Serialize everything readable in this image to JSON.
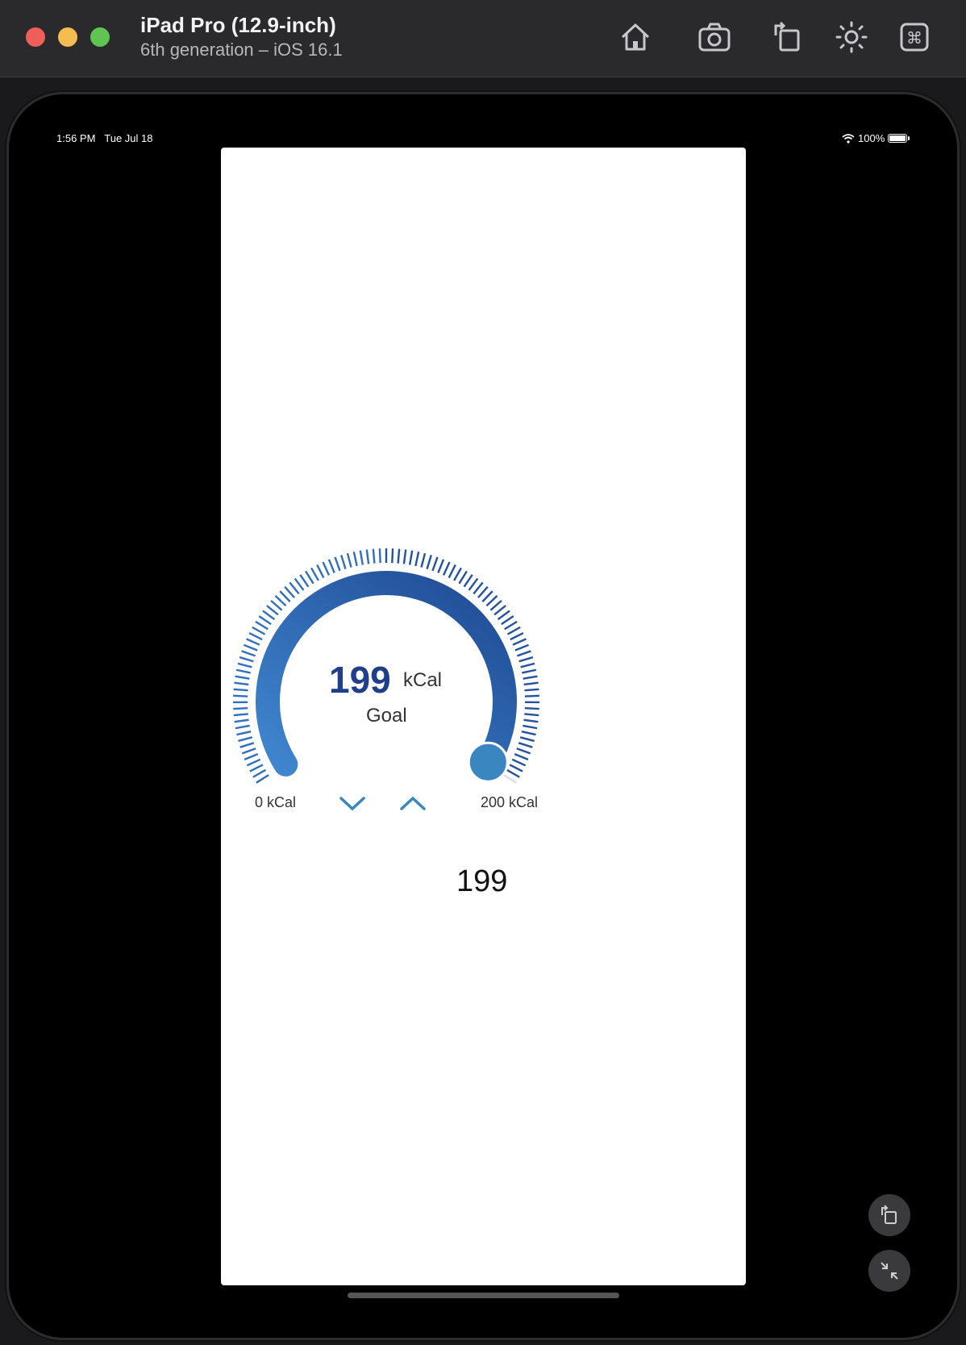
{
  "window": {
    "title": "iPad Pro (12.9-inch)",
    "subtitle": "6th generation – iOS 16.1"
  },
  "toolbar_icons": [
    "home-icon",
    "camera-icon",
    "rotate-icon",
    "brightness-icon",
    "command-icon"
  ],
  "status_bar": {
    "time": "1:56 PM",
    "date": "Tue Jul 18",
    "battery": "100%"
  },
  "gauge": {
    "value": "199",
    "unit": "kCal",
    "caption": "Goal",
    "min_label": "0 kCal",
    "max_label": "200 kCal",
    "min": 0,
    "max": 200,
    "current": 199,
    "track_color_start": "#3f86cf",
    "track_color_end": "#1f4a93",
    "thumb_color": "#3a86c0"
  },
  "readout": "199",
  "colors": {
    "accent": "#3a86c0",
    "value_text": "#1f3f8a"
  }
}
